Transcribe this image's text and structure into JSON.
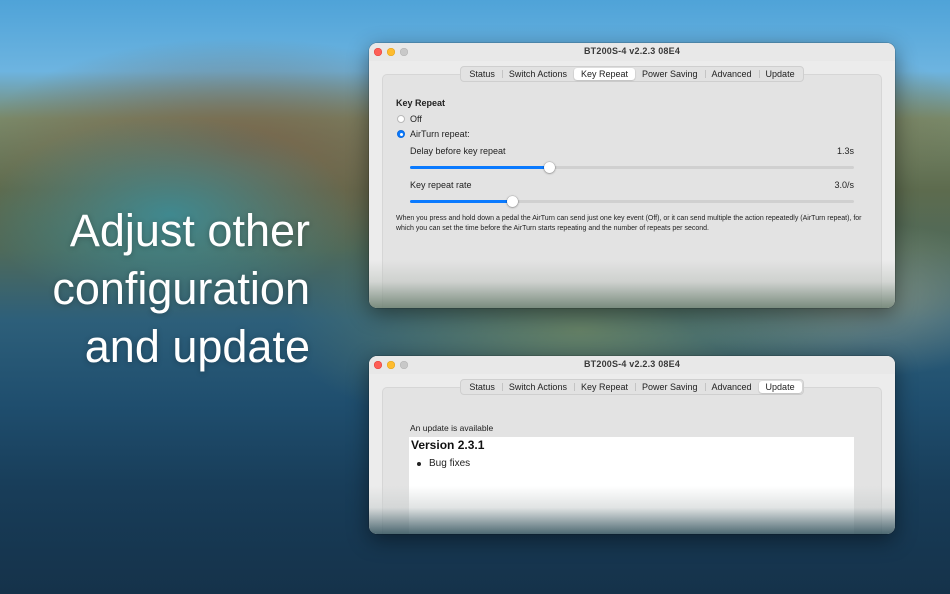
{
  "headline": [
    "Adjust other",
    "configuration",
    "and update"
  ],
  "windows": [
    {
      "title": "BT200S-4 v2.2.3 08E4",
      "tabs": [
        "Status",
        "Switch Actions",
        "Key Repeat",
        "Power Saving",
        "Advanced",
        "Update"
      ],
      "active_tab": "Key Repeat",
      "section_title": "Key Repeat",
      "radio_off_label": "Off",
      "radio_airturn_label": "AirTurn repeat:",
      "selected_radio": "AirTurn repeat:",
      "delay": {
        "label": "Delay before key repeat",
        "value_text": "1.3s",
        "fraction": 0.315
      },
      "rate": {
        "label": "Key repeat rate",
        "value_text": "3.0/s",
        "fraction": 0.231
      },
      "description": "When you press and hold down a pedal the AirTurn can send just one key event (Off),  or it can send multiple the action repeatedly (AirTurn repeat), for which you can set the time before the AirTurn starts repeating and the number of repeats per second."
    },
    {
      "title": "BT200S-4 v2.2.3 08E4",
      "tabs": [
        "Status",
        "Switch Actions",
        "Key Repeat",
        "Power Saving",
        "Advanced",
        "Update"
      ],
      "active_tab": "Update",
      "update_label": "An update is available",
      "notes_heading": "Version 2.3.1",
      "notes_items": [
        "Bug fixes"
      ]
    }
  ],
  "colors": {
    "accent": "#0a7aff",
    "close": "#fe5f57",
    "minimize": "#febc2e"
  }
}
